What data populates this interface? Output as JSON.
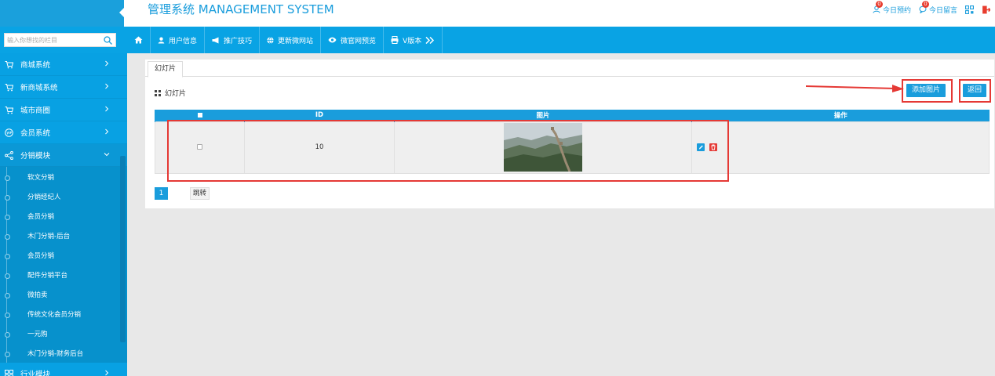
{
  "header": {
    "app_title": "管理系统 MANAGEMENT SYSTEM",
    "links": [
      {
        "label": "今日预约",
        "badge": "0"
      },
      {
        "label": "今日留言",
        "badge": "0"
      }
    ]
  },
  "search": {
    "placeholder": "输入你想找的栏目"
  },
  "topnav": {
    "items": [
      {
        "label": "用户信息"
      },
      {
        "label": "推广技巧"
      },
      {
        "label": "更新微网站"
      },
      {
        "label": "微官网预览"
      },
      {
        "label": "V版本"
      }
    ]
  },
  "sidebar": {
    "items": [
      {
        "label": "商城系统"
      },
      {
        "label": "新商城系统"
      },
      {
        "label": "城市商圈"
      },
      {
        "label": "会员系统"
      },
      {
        "label": "分销模块"
      },
      {
        "label": "行业模块"
      }
    ],
    "subitems": [
      {
        "label": "软文分销"
      },
      {
        "label": "分销经纪人"
      },
      {
        "label": "会员分销"
      },
      {
        "label": "木门分销-后台"
      },
      {
        "label": "会员分销"
      },
      {
        "label": "配件分销平台"
      },
      {
        "label": "微拍卖"
      },
      {
        "label": "传统文化会员分销"
      },
      {
        "label": "一元购"
      },
      {
        "label": "木门分销-财务后台"
      }
    ]
  },
  "main": {
    "tab_label": "幻灯片",
    "section_title": "幻灯片",
    "add_button": "添加图片",
    "back_button": "返回",
    "table": {
      "headers": {
        "id": "ID",
        "image": "图片",
        "ops": "操作"
      },
      "rows": [
        {
          "id": "10"
        }
      ]
    },
    "pager": {
      "current": "1",
      "go_label": "跳转"
    }
  },
  "colors": {
    "primary": "#1a9ddc",
    "sidebar": "#08a1e3",
    "highlight": "#e53935"
  }
}
